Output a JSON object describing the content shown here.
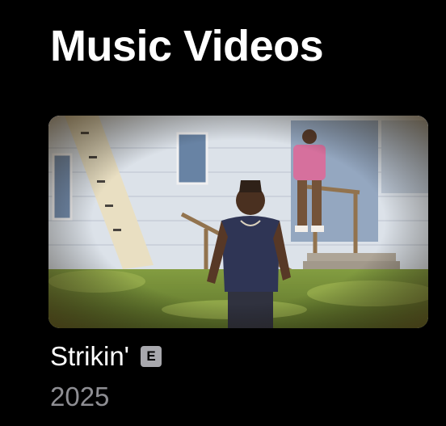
{
  "section": {
    "title": "Music Videos"
  },
  "video": {
    "title": "Strikin'",
    "explicit_badge": "E",
    "year": "2025"
  },
  "colors": {
    "background": "#000000",
    "title_text": "#ffffff",
    "subtitle_text": "#8e8e93",
    "badge_bg": "#a8a8ad"
  }
}
